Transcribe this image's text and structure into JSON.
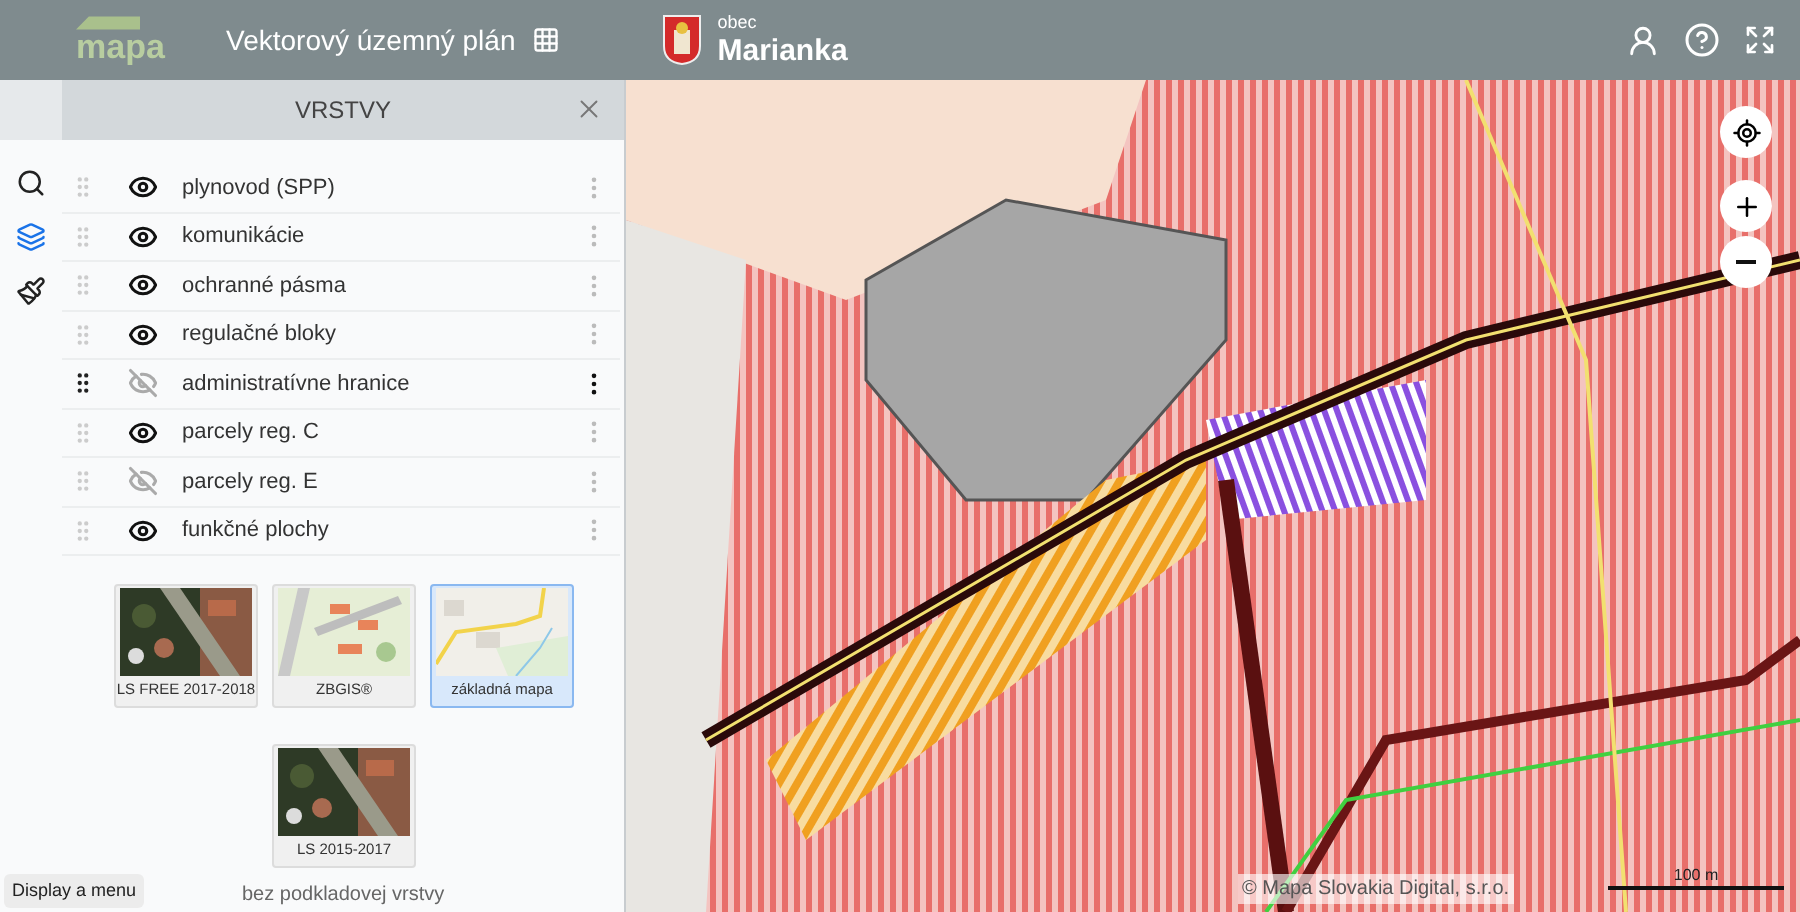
{
  "header": {
    "logo_text": "mapa",
    "app_title": "Vektorový územný plán",
    "municipality_label": "obec",
    "municipality_name": "Marianka"
  },
  "sidebar": {
    "rail": [
      {
        "kind": "search",
        "selected": false
      },
      {
        "kind": "layers",
        "selected": true
      },
      {
        "kind": "brush",
        "selected": false
      }
    ]
  },
  "layers_panel": {
    "title": "VRSTVY",
    "layers": [
      {
        "name": "plynovod (SPP)",
        "visible": true,
        "highlighted": false
      },
      {
        "name": "komunikácie",
        "visible": true,
        "highlighted": false
      },
      {
        "name": "ochranné pásma",
        "visible": true,
        "highlighted": false
      },
      {
        "name": "regulačné bloky",
        "visible": true,
        "highlighted": false
      },
      {
        "name": "administratívne hranice",
        "visible": false,
        "highlighted": true
      },
      {
        "name": "parcely reg. C",
        "visible": true,
        "highlighted": false
      },
      {
        "name": "parcely reg. E",
        "visible": false,
        "highlighted": false
      },
      {
        "name": "funkčné plochy",
        "visible": true,
        "highlighted": false
      }
    ],
    "basemaps": [
      {
        "label": "LS FREE 2017-2018",
        "kind": "aerial",
        "selected": false
      },
      {
        "label": "ZBGIS®",
        "kind": "topo",
        "selected": false
      },
      {
        "label": "základná mapa",
        "kind": "street",
        "selected": true
      },
      {
        "label": "LS 2015-2017",
        "kind": "aerial",
        "selected": false
      }
    ],
    "no_basemap": "bez podkladovej vrstvy"
  },
  "tooltip": "Display a menu",
  "map": {
    "attribution": "© Mapa Slovakia Digital, s.r.o.",
    "scale": "100 m"
  }
}
